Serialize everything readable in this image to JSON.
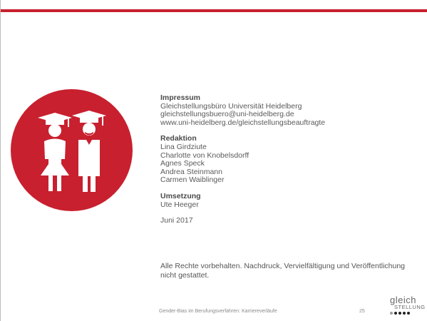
{
  "impressum": {
    "heading": "Impressum",
    "lines": [
      "Gleichstellungsbüro Universität Heidelberg",
      "gleichstellungsbuero@uni-heidelberg.de",
      "www.uni-heidelberg.de/gleichstellungsbeauftragte"
    ]
  },
  "redaktion": {
    "heading": "Redaktion",
    "names": [
      "Lina Girdziute",
      "Charlotte von Knobelsdorff",
      "Agnes Speck",
      "Andrea Steinmann",
      "Carmen Waiblinger"
    ]
  },
  "umsetzung": {
    "heading": "Umsetzung",
    "name": "Ute Heeger"
  },
  "date": "Juni 2017",
  "rights": "Alle Rechte vorbehalten. Nachdruck, Vervielfältigung und Veröffentlichung nicht gestattet.",
  "footer": {
    "title": "Gender-Bias im Berufungsverfahren: Karriereverläufe",
    "page": "25"
  },
  "logo": {
    "word1": "gleich",
    "word2": "STELLUNG"
  },
  "colors": {
    "accent": "#c8202f"
  },
  "icons": {
    "emblem": "graduates-icon"
  }
}
